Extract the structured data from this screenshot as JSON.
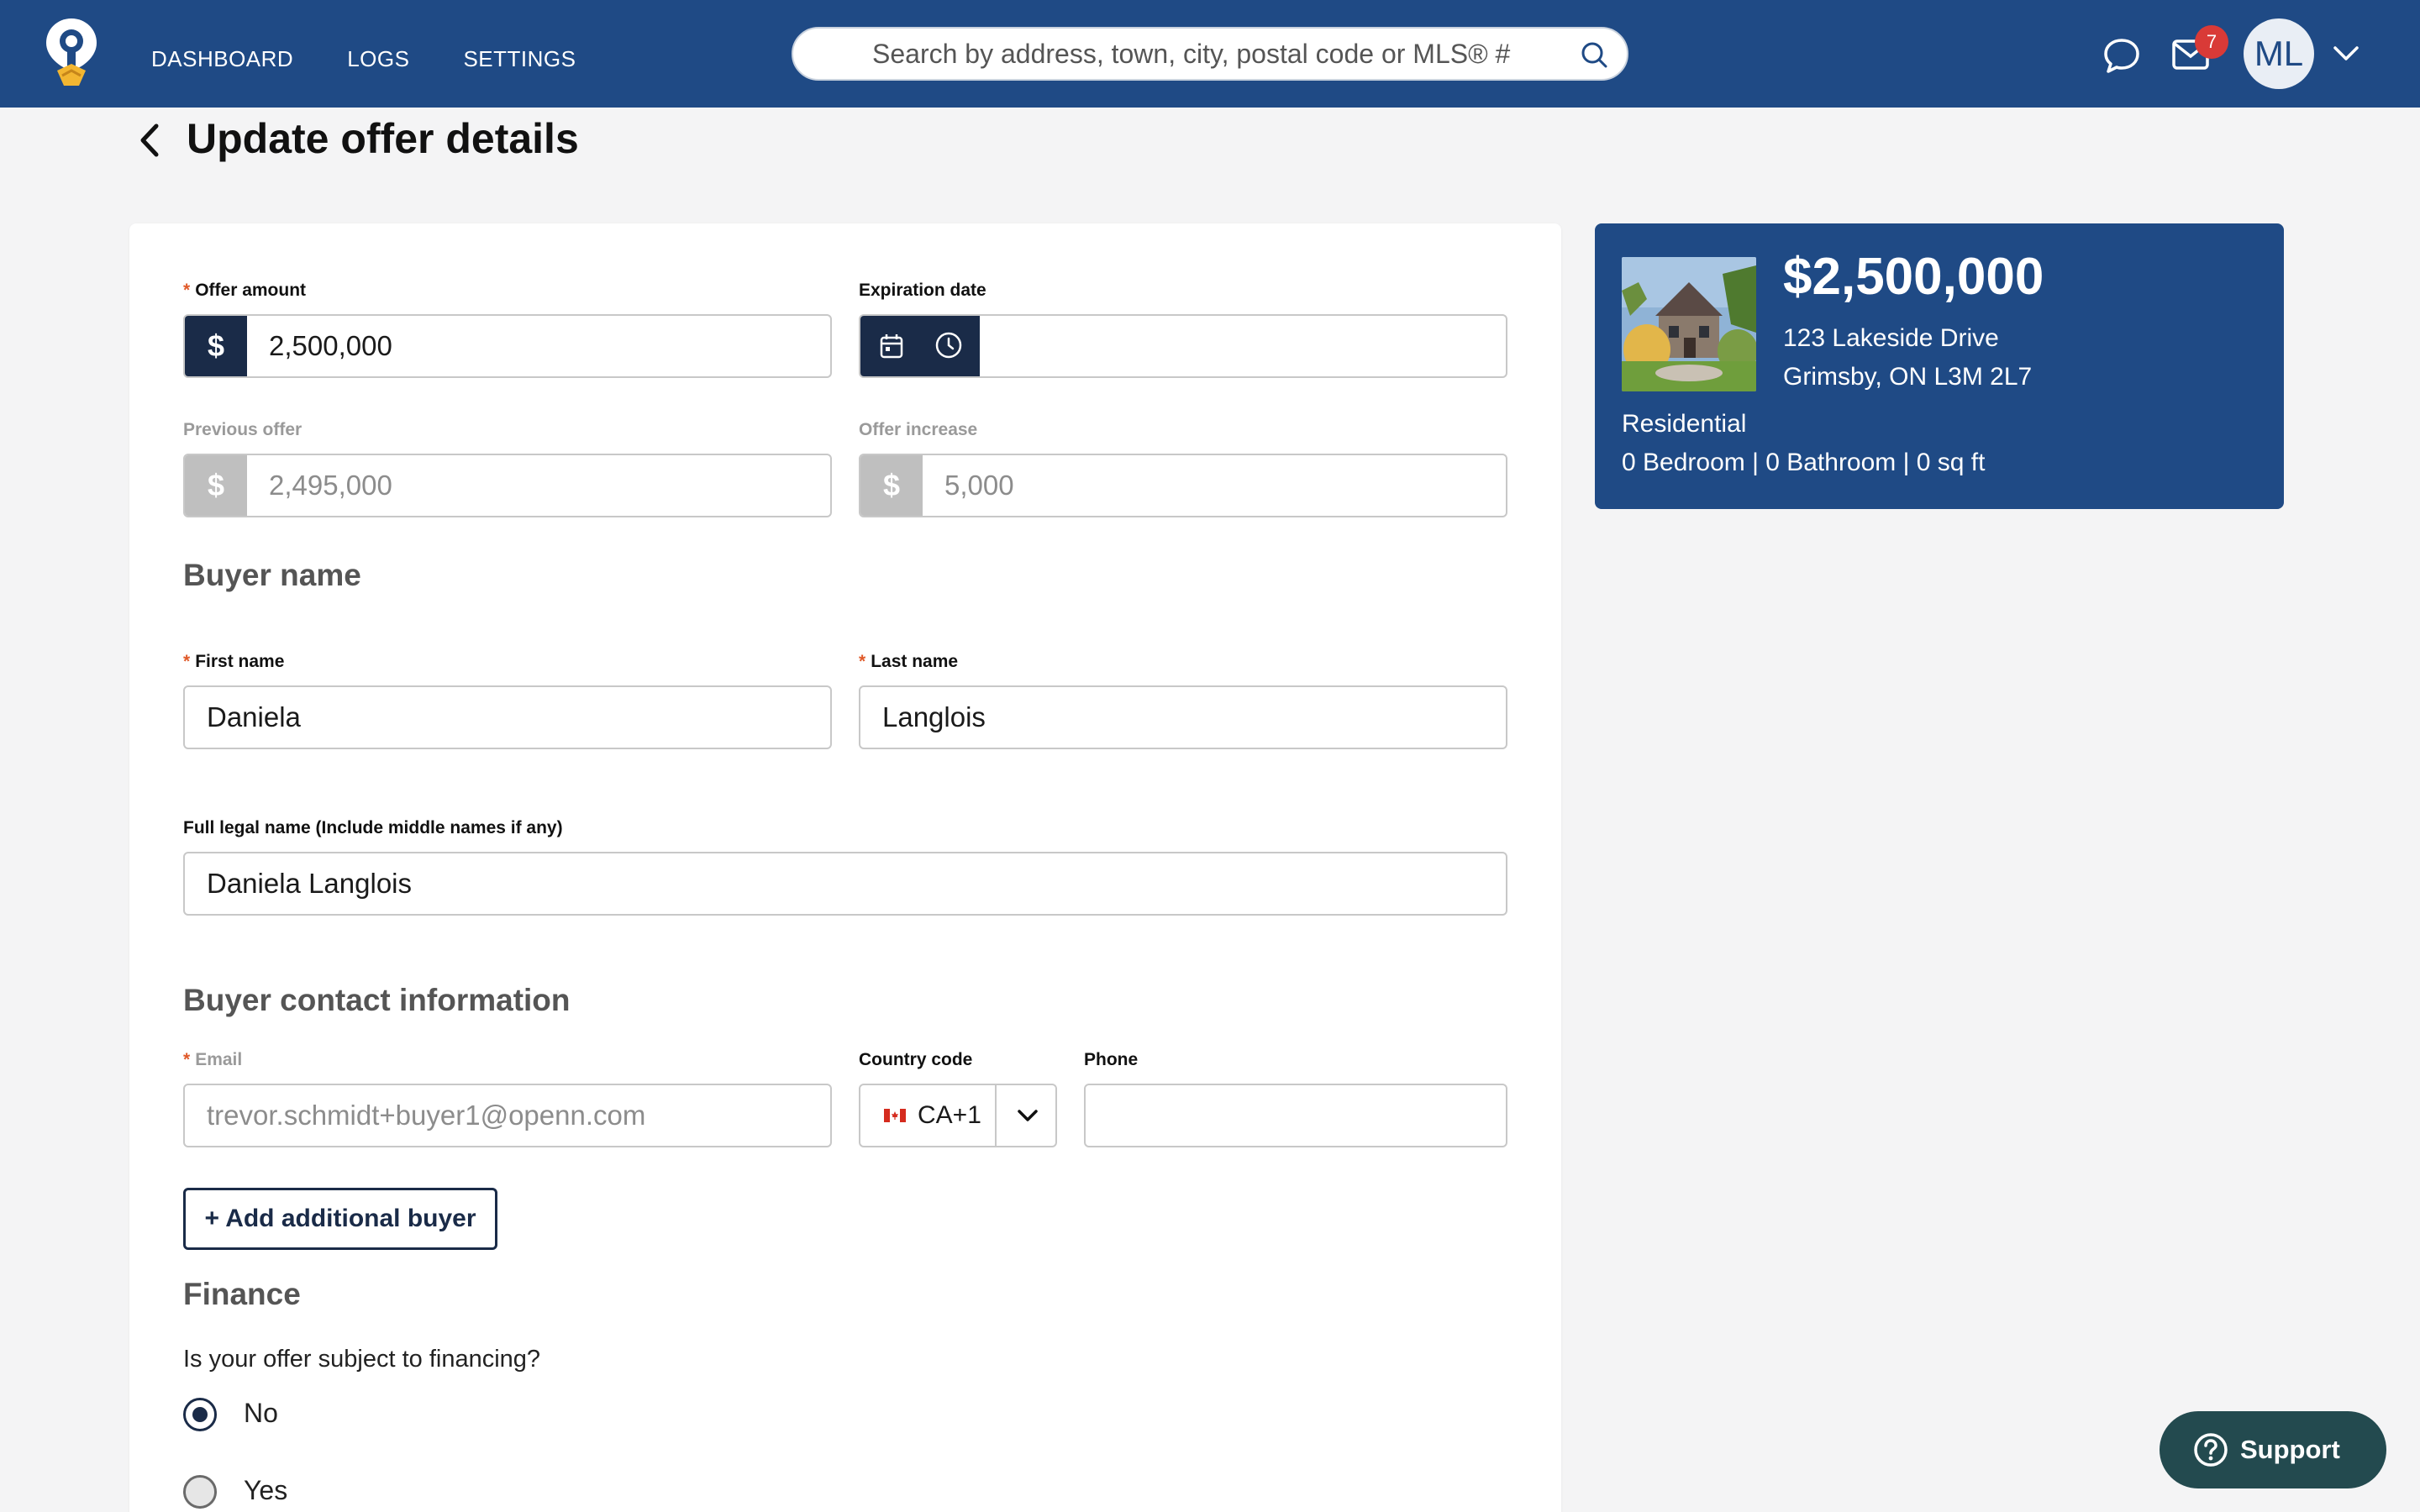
{
  "nav": {
    "items": [
      "DASHBOARD",
      "LOGS",
      "SETTINGS"
    ]
  },
  "search": {
    "placeholder": "Search by address, town, city, postal code or MLS® #"
  },
  "header": {
    "notification_count": "7",
    "avatar_initials": "ML",
    "title": "Update offer details"
  },
  "form": {
    "offer_amount": {
      "label": "Offer amount",
      "prefix": "$",
      "value": "2,500,000"
    },
    "expiration_date": {
      "label": "Expiration date",
      "value": ""
    },
    "previous_offer": {
      "label": "Previous offer",
      "prefix": "$",
      "value": "2,495,000"
    },
    "offer_increase": {
      "label": "Offer increase",
      "prefix": "$",
      "value": "5,000"
    },
    "buyer_name_title": "Buyer name",
    "first_name": {
      "label": "First name",
      "value": "Daniela"
    },
    "last_name": {
      "label": "Last name",
      "value": "Langlois"
    },
    "legal_name": {
      "label": "Full legal name (Include middle names if any)",
      "value": "Daniela Langlois"
    },
    "contact_title": "Buyer contact information",
    "email": {
      "label": "Email",
      "value": "trevor.schmidt+buyer1@openn.com"
    },
    "country_code": {
      "label": "Country code",
      "value": "CA+1"
    },
    "phone": {
      "label": "Phone",
      "value": ""
    },
    "add_buyer_label": "+ Add additional buyer",
    "finance_title": "Finance",
    "finance_question": "Is your offer subject to financing?",
    "finance_options": [
      {
        "label": "No",
        "selected": true
      },
      {
        "label": "Yes",
        "selected": false
      }
    ],
    "required_marker": "*"
  },
  "property": {
    "price": "$2,500,000",
    "address_line1": "123 Lakeside Drive",
    "address_line2": "Grimsby, ON L3M 2L7",
    "type": "Residential",
    "specs": "0 Bedroom | 0 Bathroom | 0 sq ft"
  },
  "support": {
    "label": "Support"
  },
  "colors": {
    "nav_bg": "#1f4a85",
    "prefix_bg": "#1a2b48",
    "required": "#e05a2a",
    "badge": "#d93a37",
    "support_bg": "#234a4f"
  },
  "icons": [
    "logo-icon",
    "search-icon",
    "chat-icon",
    "mail-icon",
    "chevron-down-icon",
    "back-icon",
    "calendar-icon",
    "clock-icon",
    "canada-flag-icon",
    "question-circle-icon"
  ]
}
